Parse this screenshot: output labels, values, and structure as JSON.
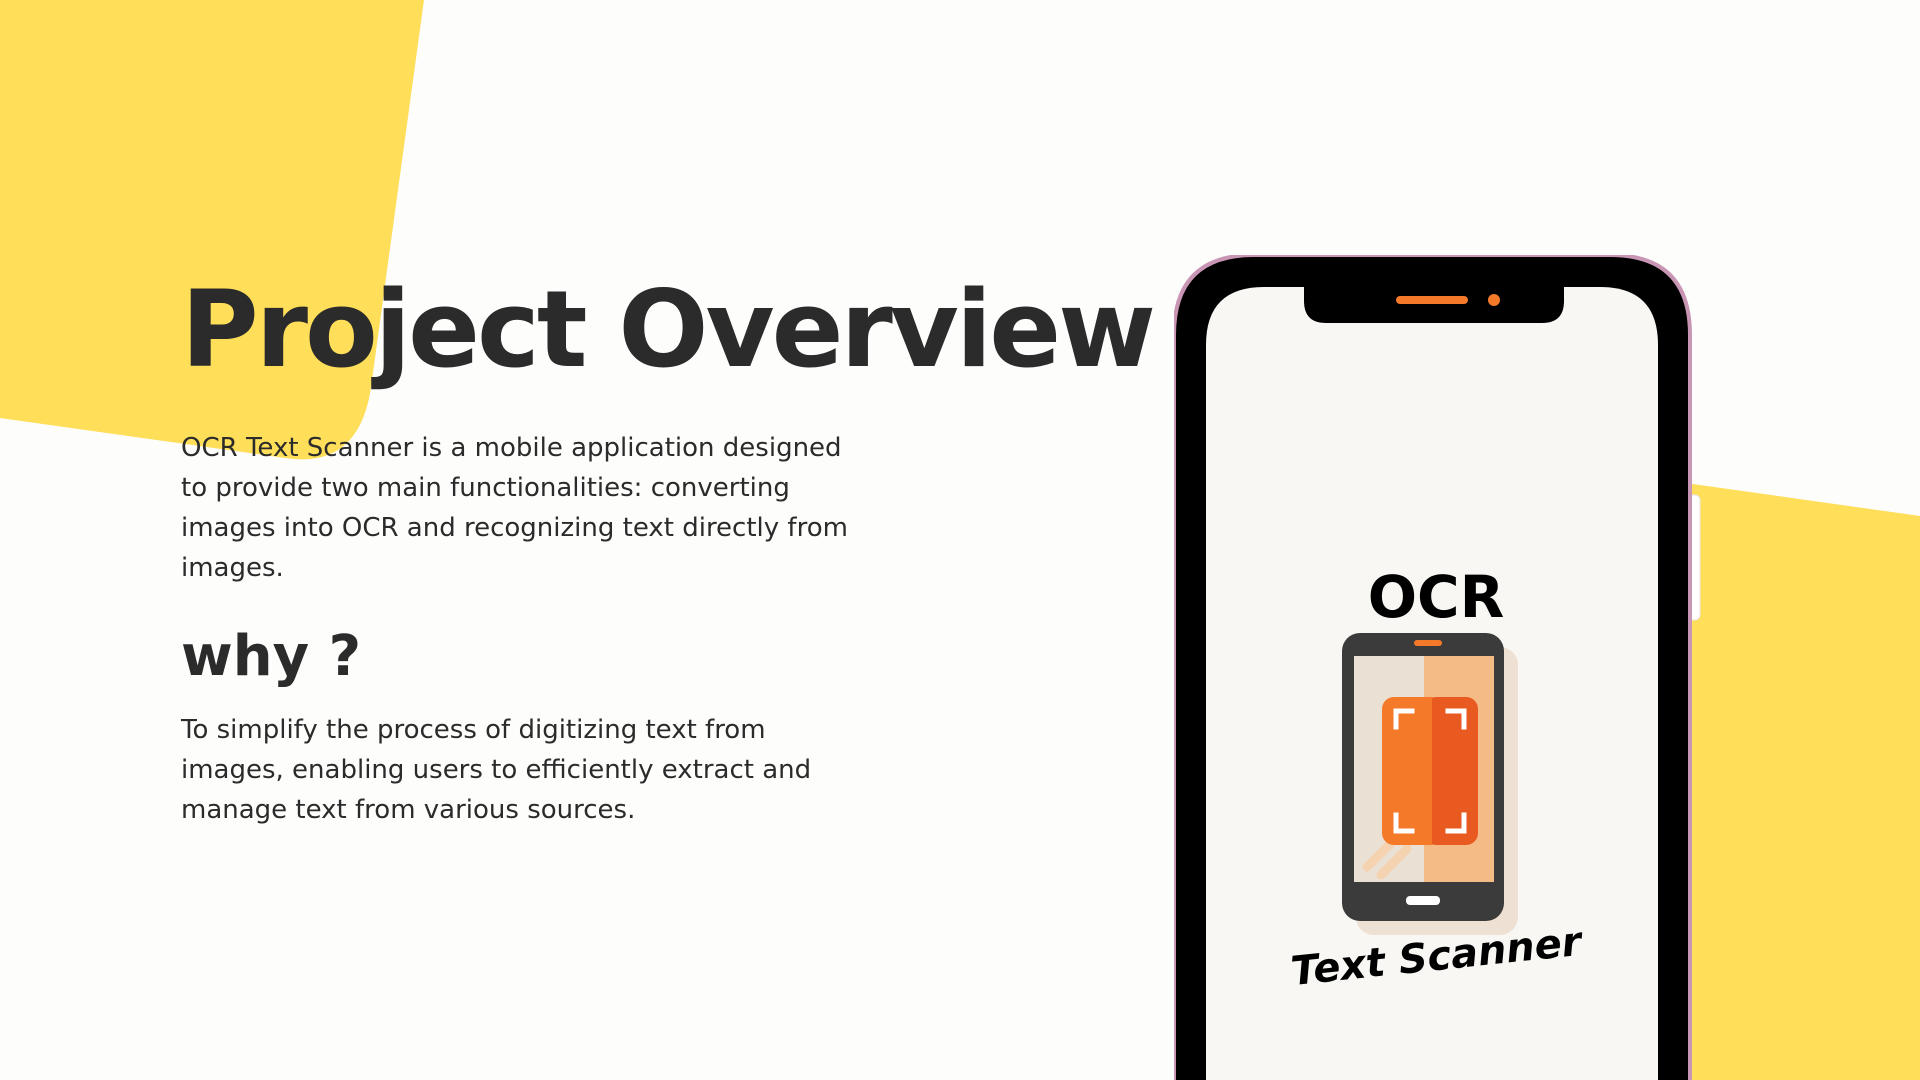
{
  "slide": {
    "title": "Project Overview",
    "description": "OCR Text Scanner is a mobile application designed to provide two main functionalities: converting images into OCR and recognizing text directly from images.",
    "why_heading": "why ?",
    "why_text": "To simplify the process of digitizing text from images, enabling users to efficiently extract and manage text from various sources."
  },
  "logo": {
    "top_text": "OCR",
    "bottom_text": "Text Scanner"
  },
  "colors": {
    "accent_yellow": "#ffde59",
    "phone_frame": "#000000",
    "phone_outline": "#c896b4",
    "screen_bg": "#f8f7f4",
    "orange": "#f47a2a",
    "dark_orange": "#e85a1f"
  }
}
